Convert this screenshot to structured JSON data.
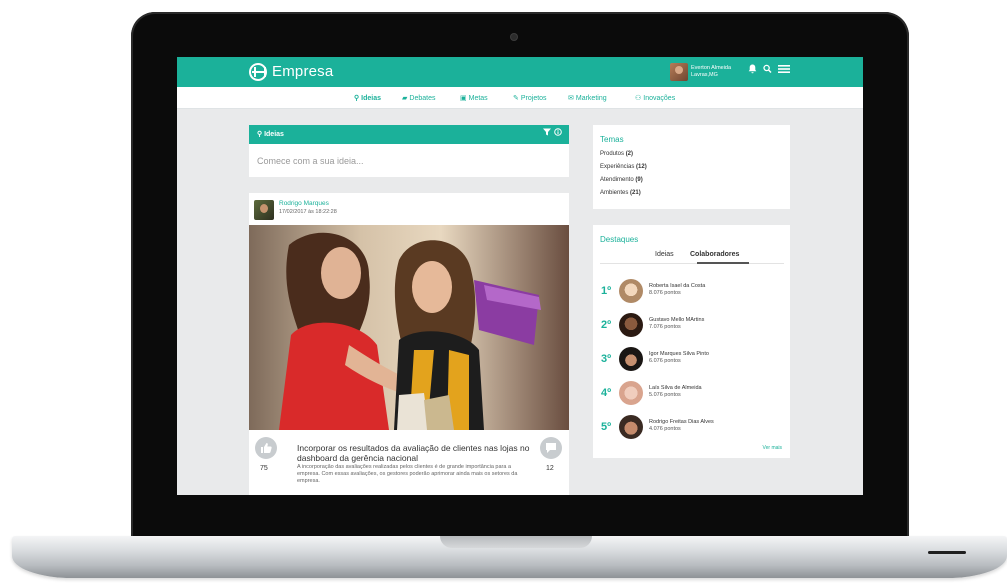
{
  "header": {
    "app_name": "Empresa",
    "user_name": "Everton Almeida",
    "user_location": "Lavras,MG",
    "bell_icon": "♪",
    "search_icon": "⌕",
    "menu_icon": "≡"
  },
  "nav": {
    "items": [
      {
        "label": "Ideias",
        "icon": "map-pin-icon",
        "active": true
      },
      {
        "label": "Debates",
        "icon": "chat-icon"
      },
      {
        "label": "Metas",
        "icon": "target-icon"
      },
      {
        "label": "Projetos",
        "icon": "wrench-icon"
      },
      {
        "label": "Marketing",
        "icon": "mail-icon"
      },
      {
        "label": "Inovações",
        "icon": "users-icon"
      }
    ]
  },
  "ideas": {
    "bar_label": "Ideias",
    "input_placeholder": "Comece com a sua ideia..."
  },
  "post": {
    "author": "Rodrigo Marques",
    "date": "17/02/2017 às 18:22:28",
    "likes": "75",
    "comments": "12",
    "title": "Incorporar os resultados da avaliação de clientes nas lojas no dashboard da gerência nacional",
    "text": "A incorporação das avaliações realizadas pelos clientes é de grande importância para a empresa. Com essas avaliações, os gestores poderão aprimorar ainda mais os setores da empresa."
  },
  "temas": {
    "title": "Temas",
    "items": [
      {
        "label": "Produtos",
        "count": "(2)"
      },
      {
        "label": "Experiências",
        "count": "(12)"
      },
      {
        "label": "Atendimento",
        "count": "(9)"
      },
      {
        "label": "Ambientes",
        "count": "(21)"
      }
    ]
  },
  "destaques": {
    "title": "Destaques",
    "tabs": [
      "Ideias",
      "Colaboradores"
    ],
    "ranking": [
      {
        "pos": "1º",
        "name": "Roberta Isael da Costa",
        "points": "8.076 pontos",
        "color": "#e9c9a4"
      },
      {
        "pos": "2º",
        "name": "Gustavo Mello MArtins",
        "points": "7.076 pontos",
        "color": "#5b3a2a"
      },
      {
        "pos": "3º",
        "name": "Igor Marques Silva Pinto",
        "points": "6.076 pontos",
        "color": "#2a2320"
      },
      {
        "pos": "4º",
        "name": "Laís Silva de Almeida",
        "points": "5.076 pontos",
        "color": "#e7c4b3"
      },
      {
        "pos": "5º",
        "name": "Rodrigo Freitas Dias Alves",
        "points": "4.076 pontos",
        "color": "#9a6e55"
      }
    ],
    "see_more": "Ver mais"
  },
  "colors": {
    "accent": "#1bb19a",
    "background": "#e9eaeb"
  }
}
